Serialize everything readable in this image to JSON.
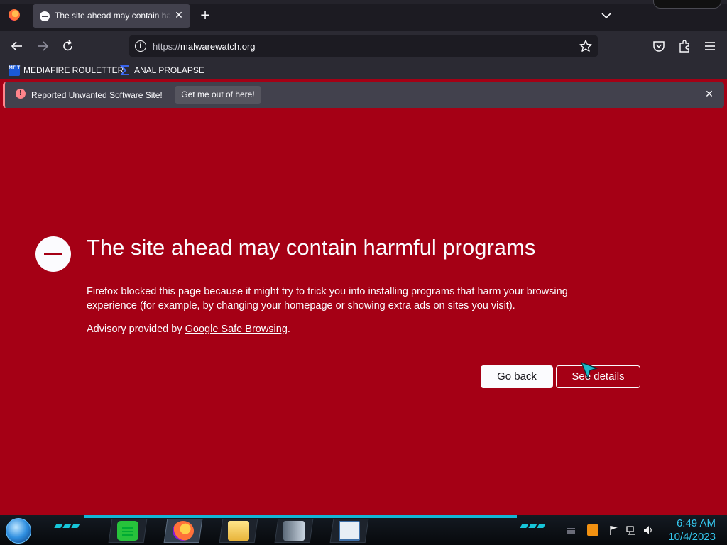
{
  "colors": {
    "warning_red": "#a50015",
    "tab_bg": "#42414d",
    "toolbar_bg": "#2b2a33",
    "taskbar_accent": "#12b6d6"
  },
  "tab": {
    "title": "The site ahead may contain harmful programs",
    "icon": "blocked-icon"
  },
  "navbar": {
    "url_scheme": "https://",
    "url_host": "malwarewatch.org"
  },
  "bookmarks": [
    {
      "label": "MEDIAFIRE ROULETTER",
      "icon": "mediafire-icon",
      "icon_text": "MF T"
    },
    {
      "label": "ANAL PROLAPSE",
      "icon": "sigma-icon"
    }
  ],
  "notification": {
    "message": "Reported Unwanted Software Site!",
    "button": "Get me out of here!"
  },
  "main": {
    "heading": "The site ahead may contain harmful programs",
    "description": "Firefox blocked this page because it might try to trick you into installing programs that harm your browsing experience (for example, by changing your homepage or showing extra ads on sites you visit).",
    "advisory_prefix": "Advisory provided by ",
    "advisory_link": "Google Safe Browsing",
    "advisory_suffix": ".",
    "go_back": "Go back",
    "see_details": "See details"
  },
  "taskbar": {
    "apps": [
      "notes-app",
      "firefox-app",
      "file-explorer-app",
      "device-app",
      "document-app"
    ],
    "time": "6:49 AM",
    "date": "10/4/2023"
  }
}
